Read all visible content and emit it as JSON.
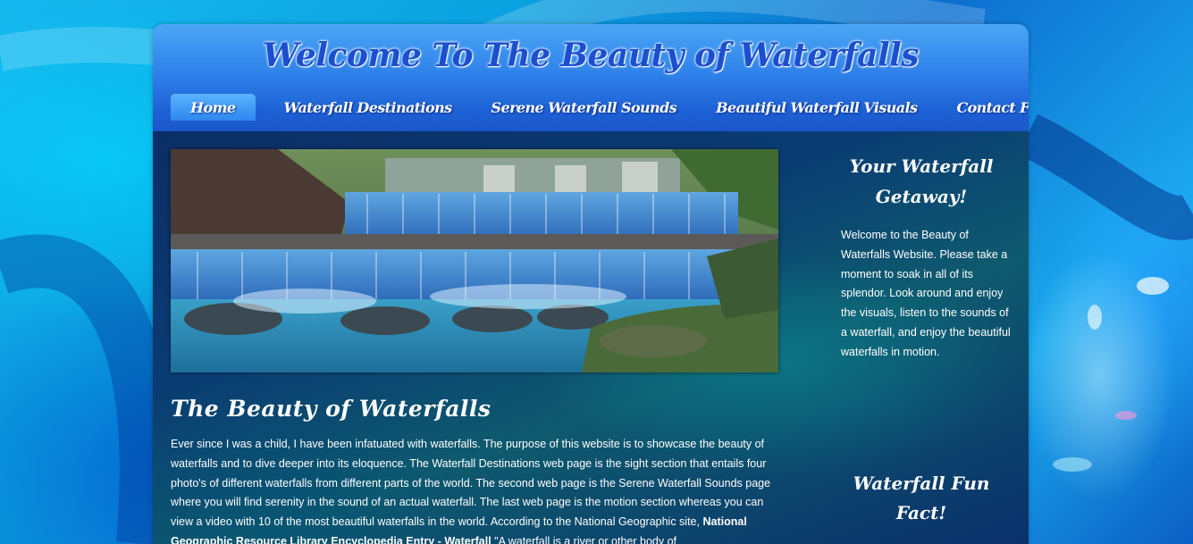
{
  "header": {
    "title": "Welcome To The Beauty of Waterfalls"
  },
  "nav": {
    "items": [
      {
        "label": "Home",
        "active": true
      },
      {
        "label": "Waterfall Destinations",
        "active": false
      },
      {
        "label": "Serene Waterfall Sounds",
        "active": false
      },
      {
        "label": "Beautiful Waterfall Visuals",
        "active": false
      },
      {
        "label": "Contact Form",
        "active": false
      }
    ]
  },
  "main": {
    "heading": "The Beauty of Waterfalls",
    "paragraph_1": "Ever since I was a child, I have been infatuated with waterfalls. The purpose of this website is to showcase the beauty of waterfalls and to dive deeper into its eloquence. The Waterfall Destinations web page is the sight section that entails four photo's of different waterfalls from different parts of the world. The second web page is the Serene Waterfall Sounds page where you will find serenity in the sound of an actual waterfall. The last web page is the motion section whereas you can view a video with 10 of the most beautiful waterfalls in the world. According to the National Geographic site,",
    "source_link": "National Geographic Resource Library Encyclopedia Entry - Waterfall",
    "quote_start": "\"A waterfall is a river or other body of"
  },
  "sidebar": {
    "heading": "Your Waterfall Getaway!",
    "text": "Welcome to the Beauty of Waterfalls Website. Please take a moment to soak in all of its splendor. Look around and enjoy the visuals, listen to the sounds of a waterfall, and enjoy the beautiful waterfalls in motion.",
    "fun_fact_heading": "Waterfall Fun Fact!"
  },
  "colors": {
    "header_top": "#4aa6f5",
    "header_bottom": "#1a56c9",
    "title_color": "#1c4fd0",
    "content_bg": "#0a3c73",
    "text": "#ffffff"
  }
}
